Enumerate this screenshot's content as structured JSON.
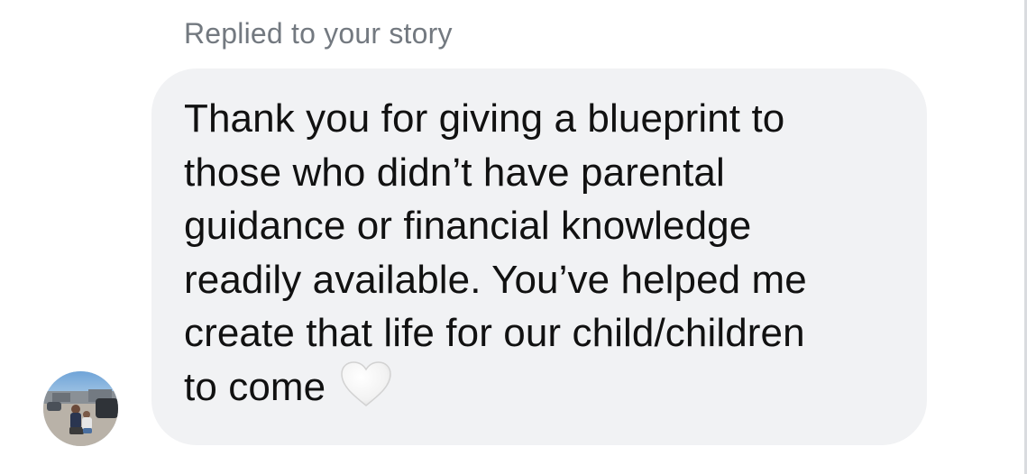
{
  "reply_context": "Replied to your story",
  "message": {
    "lines": [
      "Thank you for giving a blueprint to",
      "those who didn’t have parental",
      "guidance or financial knowledge",
      "readily available. You’ve helped me",
      "create that life for our child/children",
      "to come"
    ],
    "trailing_emoji": "white-heart-icon"
  },
  "colors": {
    "bubble_background": "#f1f2f4",
    "message_text": "#111111",
    "context_text": "#737980"
  }
}
